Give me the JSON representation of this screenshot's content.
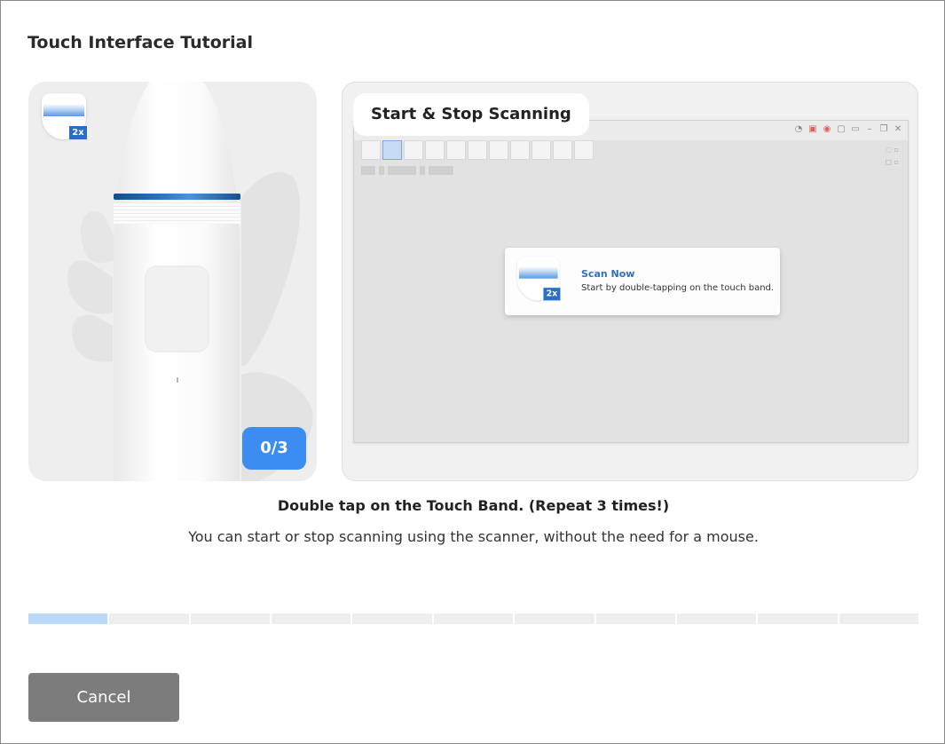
{
  "dialog": {
    "title": "Touch Interface Tutorial",
    "cancel_label": "Cancel"
  },
  "scanner_panel": {
    "tap_badge": "2x",
    "counter": "0/3",
    "tap_count_current": 0,
    "tap_count_total": 3
  },
  "screen_panel": {
    "label": "Start & Stop Scanning",
    "toast": {
      "badge": "2x",
      "title": "Scan Now",
      "text": "Start by double-tapping on the touch band."
    }
  },
  "instruction": {
    "title": "Double tap on the Touch Band. (Repeat 3 times!)",
    "text": "You can start or stop scanning using the scanner, without the need for a mouse."
  },
  "progress": {
    "steps_total": 11,
    "steps_done": 1,
    "done_color": "#bcd8f8",
    "pending_color": "#eeeeee"
  },
  "colors": {
    "accent": "#3c8df1",
    "button_gray": "#7c7c7c",
    "touch_band": "#2c78c8"
  },
  "icons": [
    "touch-band-icon",
    "scanner-device",
    "window-controls"
  ]
}
